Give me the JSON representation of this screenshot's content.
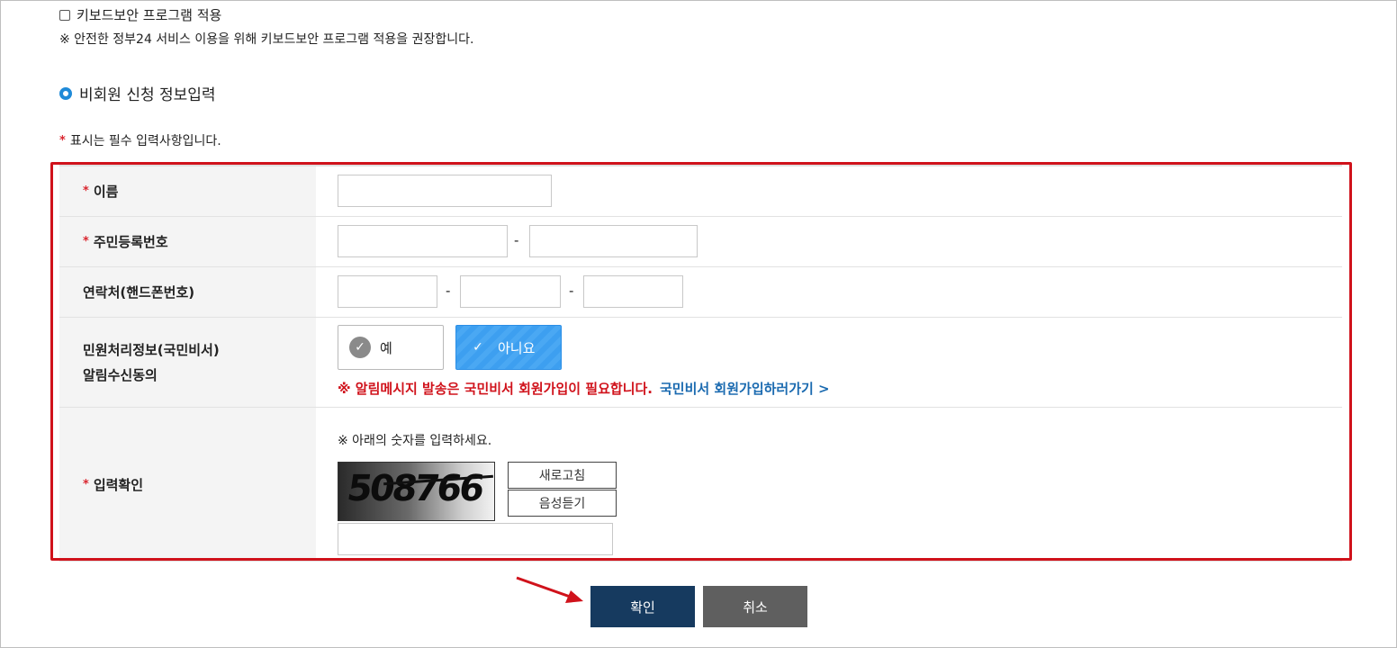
{
  "keyboard_security": {
    "checkbox_label": "키보드보안 프로그램 적용",
    "note": "※ 안전한 정부24 서비스 이용을 위해 키보드보안 프로그램 적용을 권장합니다."
  },
  "section": {
    "title": "비회원 신청 정보입력",
    "required_note": "표시는 필수 입력사항입니다.",
    "required_mark": "*"
  },
  "form": {
    "name_label": "이름",
    "rrn_label": "주민등록번호",
    "rrn_separator": "-",
    "phone_label": "연락처(핸드폰번호)",
    "phone_separator": "-",
    "consent_label_line1": "민원처리정보(국민비서)",
    "consent_label_line2": "알림수신동의",
    "consent_yes": "예",
    "consent_no": "아니요",
    "consent_selected": "아니요",
    "consent_notice": "※  알림메시지 발송은 국민비서 회원가입이 필요합니다.",
    "consent_link": "국민비서 회원가입하러가기 >",
    "captcha_label": "입력확인",
    "captcha_note": "※ 아래의 숫자를 입력하세요.",
    "captcha_text": "508766",
    "refresh_button": "새로고침",
    "audio_button": "음성듣기"
  },
  "actions": {
    "confirm": "확인",
    "cancel": "취소"
  },
  "colors": {
    "highlight_border": "#d0121b",
    "confirm_button": "#163a5f",
    "cancel_button": "#5f5f5f",
    "selected_option": "#3d9ff0"
  }
}
